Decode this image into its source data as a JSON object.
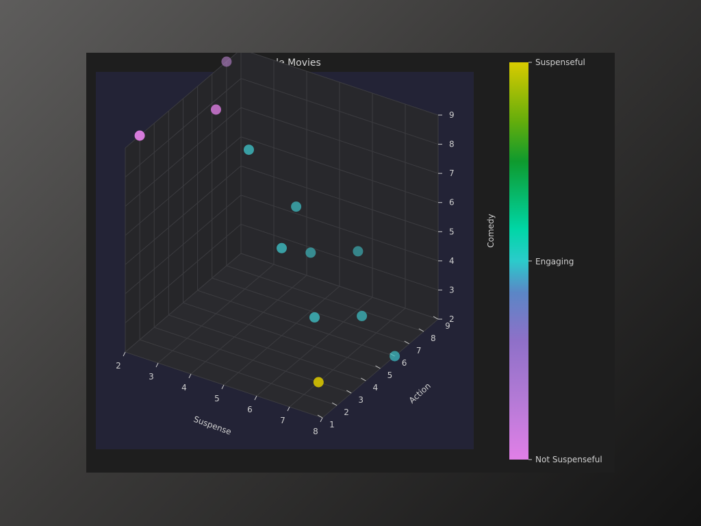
{
  "chart_data": {
    "type": "scatter",
    "projection": "3d",
    "title": "Sample Movies",
    "xlabel": "Suspense",
    "ylabel": "Action",
    "zlabel": "Comedy",
    "x_ticks": [
      2,
      3,
      4,
      5,
      6,
      7,
      8
    ],
    "y_ticks": [
      1,
      2,
      3,
      4,
      5,
      6,
      7,
      8,
      9
    ],
    "z_ticks": [
      2,
      3,
      4,
      5,
      6,
      7,
      8,
      9
    ],
    "xlim": [
      2,
      8
    ],
    "ylim": [
      1,
      9
    ],
    "zlim": [
      2,
      9
    ],
    "grid": true,
    "points": [
      {
        "suspense": 2,
        "action": 2,
        "comedy": 9,
        "colorscale": 0
      },
      {
        "suspense": 3,
        "action": 5,
        "comedy": 9,
        "colorscale": 0
      },
      {
        "suspense": 2,
        "action": 8,
        "comedy": 9,
        "colorscale": 0.1
      },
      {
        "suspense": 4,
        "action": 5,
        "comedy": 8,
        "colorscale": 0.5
      },
      {
        "suspense": 5,
        "action": 6,
        "comedy": 6,
        "colorscale": 0.5
      },
      {
        "suspense": 5,
        "action": 5,
        "comedy": 5,
        "colorscale": 0.5
      },
      {
        "suspense": 5,
        "action": 7,
        "comedy": 4,
        "colorscale": 0.5
      },
      {
        "suspense": 6,
        "action": 8,
        "comedy": 4,
        "colorscale": 0.5
      },
      {
        "suspense": 6,
        "action": 5,
        "comedy": 3,
        "colorscale": 0.5
      },
      {
        "suspense": 7,
        "action": 6,
        "comedy": 3,
        "colorscale": 0.5
      },
      {
        "suspense": 8,
        "action": 6,
        "comedy": 2,
        "colorscale": 0.5
      },
      {
        "suspense": 7,
        "action": 3,
        "comedy": 2,
        "colorscale": 1
      }
    ],
    "colorbar": {
      "labels": [
        "Not Suspenseful",
        "Engaging",
        "Suspenseful"
      ],
      "colors": [
        "#e17fe7",
        "#8e70c8",
        "#5b86c6",
        "#2bcbcb",
        "#03a57d",
        "#0e9a2e",
        "#7ab00b",
        "#d9cb00"
      ]
    }
  }
}
